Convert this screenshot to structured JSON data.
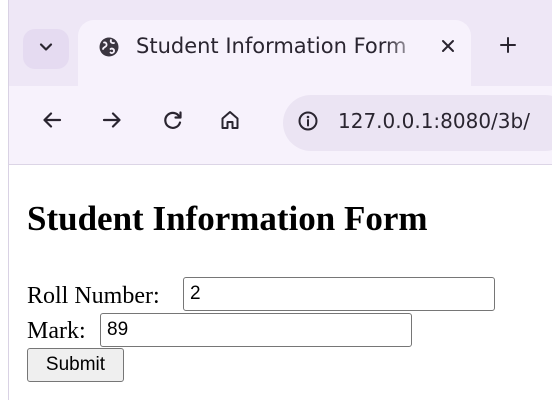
{
  "browser": {
    "tab": {
      "title": "Student Information Form"
    },
    "address_bar": {
      "url": "127.0.0.1:8080/3b/"
    }
  },
  "page": {
    "heading": "Student Information Form",
    "form": {
      "roll_number": {
        "label": "Roll Number:",
        "value": "2"
      },
      "mark": {
        "label": "Mark:",
        "value": "89"
      },
      "submit_label": "Submit"
    }
  },
  "icons": {
    "tab_list": "chevron-down-icon",
    "favicon": "globe-icon",
    "tab_close": "close-icon",
    "new_tab": "plus-icon",
    "back": "arrow-left-icon",
    "forward": "arrow-right-icon",
    "reload": "reload-icon",
    "home": "home-icon",
    "site_info": "info-icon"
  },
  "colors": {
    "tabstrip": "#eee7f6",
    "toolbar": "#f7f2fc",
    "urlbar": "#ebe4f3"
  }
}
